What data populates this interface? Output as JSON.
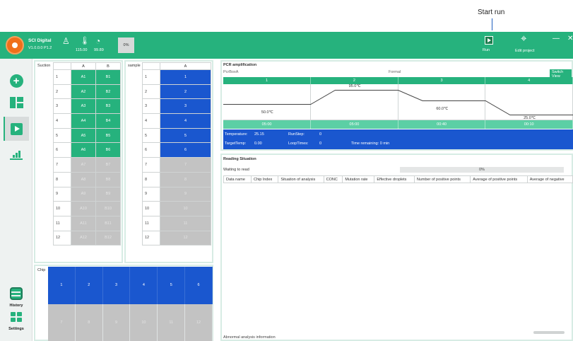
{
  "annotation": {
    "start_run": "Start run"
  },
  "app": {
    "name": "SCI Digital",
    "version": "V1.0.0.0 P1.2"
  },
  "status": {
    "value1": "115.00",
    "value2": "99.89",
    "percent": "0%"
  },
  "toolbar": {
    "run_label": "Run",
    "edit_label": "Edit project",
    "minimize": "—",
    "close": "✕"
  },
  "sidebar": {
    "history_label": "History",
    "settings_label": "Settings"
  },
  "suction": {
    "title": "Suction",
    "columns": [
      "A",
      "B"
    ],
    "rows": [
      {
        "idx": "1",
        "a": "A1",
        "b": "B1",
        "state": "g"
      },
      {
        "idx": "2",
        "a": "A2",
        "b": "B2",
        "state": "g"
      },
      {
        "idx": "3",
        "a": "A3",
        "b": "B3",
        "state": "g"
      },
      {
        "idx": "4",
        "a": "A4",
        "b": "B4",
        "state": "g"
      },
      {
        "idx": "5",
        "a": "A5",
        "b": "B5",
        "state": "g"
      },
      {
        "idx": "6",
        "a": "A6",
        "b": "B6",
        "state": "g"
      },
      {
        "idx": "7",
        "a": "A7",
        "b": "B7",
        "state": "x"
      },
      {
        "idx": "8",
        "a": "A8",
        "b": "B8",
        "state": "x"
      },
      {
        "idx": "9",
        "a": "A9",
        "b": "B9",
        "state": "x"
      },
      {
        "idx": "10",
        "a": "A10",
        "b": "B10",
        "state": "x"
      },
      {
        "idx": "11",
        "a": "A11",
        "b": "B11",
        "state": "x"
      },
      {
        "idx": "12",
        "a": "A12",
        "b": "B12",
        "state": "x"
      }
    ]
  },
  "sample": {
    "title": "sample",
    "columns": [
      "A"
    ],
    "rows": [
      {
        "idx": "1",
        "a": "1",
        "state": "b"
      },
      {
        "idx": "2",
        "a": "2",
        "state": "b"
      },
      {
        "idx": "3",
        "a": "3",
        "state": "b"
      },
      {
        "idx": "4",
        "a": "4",
        "state": "b"
      },
      {
        "idx": "5",
        "a": "5",
        "state": "b"
      },
      {
        "idx": "6",
        "a": "6",
        "state": "b"
      },
      {
        "idx": "7",
        "a": "7",
        "state": "x"
      },
      {
        "idx": "8",
        "a": "8",
        "state": "x"
      },
      {
        "idx": "9",
        "a": "9",
        "state": "x"
      },
      {
        "idx": "10",
        "a": "10",
        "state": "x"
      },
      {
        "idx": "11",
        "a": "11",
        "state": "x"
      },
      {
        "idx": "12",
        "a": "12",
        "state": "x"
      }
    ]
  },
  "chip": {
    "title": "Chip",
    "cells": [
      {
        "label": "1",
        "state": "b"
      },
      {
        "label": "2",
        "state": "b"
      },
      {
        "label": "3",
        "state": "b"
      },
      {
        "label": "4",
        "state": "b"
      },
      {
        "label": "5",
        "state": "b"
      },
      {
        "label": "6",
        "state": "b"
      },
      {
        "label": "7",
        "state": "x"
      },
      {
        "label": "8",
        "state": "x"
      },
      {
        "label": "9",
        "state": "x"
      },
      {
        "label": "10",
        "state": "x"
      },
      {
        "label": "11",
        "state": "x"
      },
      {
        "label": "12",
        "state": "x"
      }
    ]
  },
  "pcr": {
    "title": "PCR amplification",
    "box_name": "PcrBoxA",
    "mode": "Formal",
    "switch_view": "Switch View",
    "steps": [
      {
        "num": "1",
        "temp": "50.0℃",
        "time": "05:00",
        "level": 0.45
      },
      {
        "num": "2",
        "temp": "95.0℃",
        "time": "05:00",
        "level": 0.85
      },
      {
        "num": "3",
        "temp": "60.0℃",
        "time": "00:40",
        "level": 0.55
      },
      {
        "num": "4",
        "temp": "25.0℃",
        "time": "00:10",
        "level": 0.15
      }
    ],
    "status": {
      "temperature_label": "Temperature:",
      "temperature": "25.15",
      "runstep_label": "RunStep:",
      "runstep": "0",
      "target_label": "TargetTemp:",
      "target": "0.00",
      "loop_label": "LoopTimes:",
      "loop": "0",
      "remaining": "Time remaining: 0 min"
    }
  },
  "reading": {
    "title": "Reading Situation",
    "status": "Waiting to read",
    "progress_text": "0%",
    "progress": 0,
    "columns": [
      "Data name",
      "Chip Index",
      "Situation of analysis",
      "CONC",
      "Mutation rate",
      "Effective droplets",
      "Number of positive points",
      "Average of positive points",
      "Average of negative"
    ],
    "abnormal": "Abnormal analysis information"
  }
}
